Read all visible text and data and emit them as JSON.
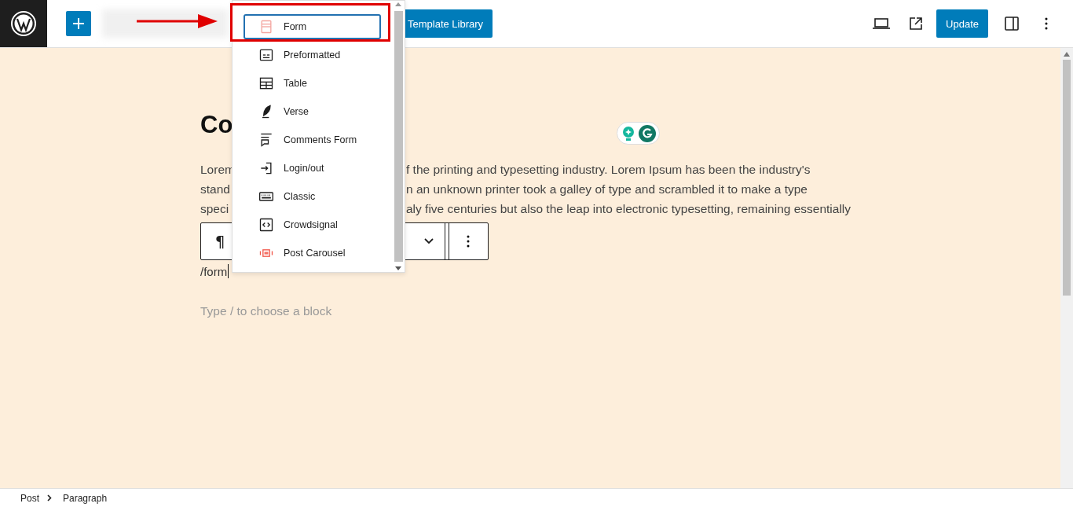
{
  "topbar": {
    "template_button": "Template Library",
    "update_button": "Update"
  },
  "heading": "Co",
  "paragraph_lines": [
    {
      "left": "Lorem",
      "right": "f the printing and typesetting industry. Lorem Ipsum has been the industry's"
    },
    {
      "left": "stand",
      "right": "n an unknown printer took a galley of type and scrambled it to make a type"
    },
    {
      "left": "speci",
      "right": "aly five centuries but also the leap into electronic typesetting, remaining essentially"
    }
  ],
  "block_toolbar": {
    "block_symbol": "¶"
  },
  "typed_text": "/form",
  "placeholder": "Type / to choose a block",
  "inserter_menu": [
    {
      "label": "Form",
      "selected": true
    },
    {
      "label": "Preformatted",
      "selected": false
    },
    {
      "label": "Table",
      "selected": false
    },
    {
      "label": "Verse",
      "selected": false
    },
    {
      "label": "Comments Form",
      "selected": false
    },
    {
      "label": "Login/out",
      "selected": false
    },
    {
      "label": "Classic",
      "selected": false
    },
    {
      "label": "Crowdsignal",
      "selected": false
    },
    {
      "label": "Post Carousel",
      "selected": false
    }
  ],
  "breadcrumbs": [
    "Post",
    "Paragraph"
  ]
}
